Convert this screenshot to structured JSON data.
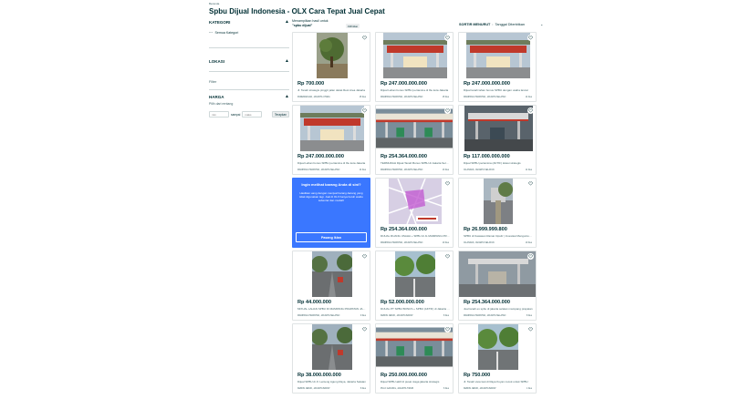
{
  "breadcrumb": "Beranda",
  "page_title": "Spbu Dijual Indonesia - OLX Cara Tepat Jual Cepat",
  "sidebar": {
    "category_heading": "KATEGORI",
    "all_categories": "Semua Kategori",
    "location_heading": "LOKASI",
    "filter_label": "Filter",
    "price_heading": "HARGA",
    "price_hint": "Pilih dari rentang",
    "min_placeholder": "min",
    "to_label": "sampai",
    "max_placeholder": "maks",
    "apply_label": "Terapkan"
  },
  "results": {
    "line1": "Menampilkan hasil untuk",
    "query": "\"spbu dijual\"",
    "badge": "198 iklan"
  },
  "sort": {
    "label": "SORTIR MENURUT",
    "separator": ":",
    "value": "Tanggal Diterbitkan"
  },
  "listings": [
    {
      "price": "Rp 700.000",
      "title": "Jl. Tanah strategis pinggir jalan dekat Rest Area Jakarta",
      "location": "Pademangan, Jakarta Utara",
      "date": "15 Des",
      "photo": "tree"
    },
    {
      "price": "Rp 247.000.000.000",
      "title": "Dijual Lahan bonus SPBU pertamina di Ibu kota Jakarta",
      "location": "Mampang Prapatan, Jakarta Selatan",
      "date": "15 Des",
      "photo": "station-red"
    },
    {
      "price": "Rp 247.000.000.000",
      "title": "Dijual tanah lahan bonus SPBU dengan usaha lancar",
      "location": "Mampang Prapatan, Jakarta Selatan",
      "date": "14 Des",
      "photo": "station-red"
    },
    {
      "price": "Rp 247.000.000.000",
      "title": "Dijual Lahan bonus SPBU pertamina di Ibu kota Jakarta",
      "location": "Mampang Prapatan, Jakarta Selatan",
      "date": "14 Des",
      "photo": "station-red"
    },
    {
      "price": "Rp 254.364.000.000",
      "title": "TERMURAH Dijual Tanah Bonus SPBU di Jakarta Selatan",
      "location": "Mampang Prapatan, Jakarta Selatan",
      "date": "13 Des",
      "photo": "station-canopy"
    },
    {
      "price": "Rp 117.000.000.000",
      "title": "Dijual SPBU pertamina (AKTIF) lokasi strategis",
      "location": "Cilandak, Jakarta Selatan",
      "date": "11 Des",
      "photo": "station-dark"
    },
    {
      "price": "Rp 254.364.000.000",
      "title": "DIJUAL RUANG USAHA + SPBU di JL MAMPANG PRAPATAN",
      "location": "Mampang Prapatan, Jakarta Selatan",
      "date": "10 Des",
      "photo": "map"
    },
    {
      "price": "Rp 26.999.999.800",
      "title": "SPBU di Kawasan Ramai Cipulir | Investasi Menguntungkan",
      "location": "Cilandak, Jakarta Selatan",
      "date": "10 Des",
      "photo": "street"
    },
    {
      "price": "Rp 44.000.000",
      "title": "MIXUAL LAHAN SPBU DI MAMPANG PRAPATAN JAKARTA",
      "location": "Mampang Prapatan, Jakarta Selatan",
      "date": "9 Des",
      "photo": "road"
    },
    {
      "price": "Rp 52.000.000.000",
      "title": "DIJUAL PT SPBU BONUS + SPBU (AKTIF) di Jakarta Barat",
      "location": "Kebon Jeruk, Jakarta Barat",
      "date": "8 Des",
      "photo": "road-green"
    },
    {
      "price": "Rp 254.364.000.000",
      "title": "Jual tanah ex spbu di jakarta selatan mampang prapatan",
      "location": "Mampang Prapatan, Jakarta Selatan",
      "date": "8 Des",
      "photo": "station-grey"
    },
    {
      "price": "Rp 38.000.000.000",
      "title": "Dijual SPBU di Jl. Lenteng Agung Raya, Jakarta Selatan",
      "location": "Kebon Jeruk, Jakarta Barat",
      "date": "8 Des",
      "photo": "road"
    },
    {
      "price": "Rp 250.000.000.000",
      "title": "Dijual SPBU aktif di pusat niaga jakarta strategis",
      "location": "Pulo Gadung, Jakarta Timur",
      "date": "6 Des",
      "photo": "station-canopy"
    },
    {
      "price": "Rp 750.000",
      "title": "Jl. Tanah view laut di Raya Kuyan cocok untuk SPBU",
      "location": "Kebon Jeruk, Jakarta Barat",
      "date": "1 Des",
      "photo": "road-green"
    }
  ],
  "promo": {
    "title": "Ingin melihat barang Anda di sini?",
    "text": "Hasilkan uang dengan menjual barang-barang yang tidak digunakan lagi. Jual di OLX hanya butuh waktu sebentar dan mudah!",
    "button": "Pasang Iklan"
  },
  "colors": {
    "text": "#002f34",
    "muted": "#406367",
    "promo_bg": "#3a77ff",
    "border": "#dfe3e4"
  }
}
